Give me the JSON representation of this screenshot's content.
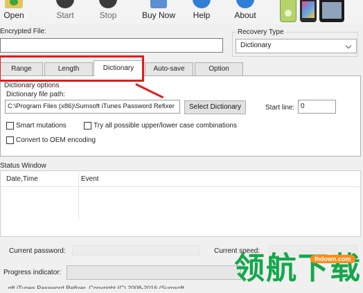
{
  "toolbar": {
    "buttons": [
      {
        "label": "Open",
        "icon": "open-folder-icon"
      },
      {
        "label": "Start",
        "icon": "play-icon"
      },
      {
        "label": "Stop",
        "icon": "stop-icon"
      },
      {
        "label": "Buy Now",
        "icon": "shopping-cart-icon"
      },
      {
        "label": "Help",
        "icon": "help-icon"
      },
      {
        "label": "About",
        "icon": "info-icon"
      }
    ],
    "devices": [
      "ipod-icon",
      "iphone-icon",
      "ipad-icon"
    ]
  },
  "encrypted_file": {
    "label": "Encrypted File:",
    "value": ""
  },
  "recovery_type": {
    "label": "Recovery Type",
    "selected": "Dictionary"
  },
  "tabs": [
    {
      "label": "Range"
    },
    {
      "label": "Length"
    },
    {
      "label": "Dictionary"
    },
    {
      "label": "Auto-save"
    },
    {
      "label": "Option"
    }
  ],
  "active_tab": "Dictionary",
  "dictionary": {
    "group_label": "Dictionary options",
    "path_label": "Dictionary file path:",
    "path_value": "C:\\Program Files (x86)\\Sumsoft iTunes Password Refixer",
    "select_button": "Select Dictionary",
    "start_line_label": "Start line:",
    "start_line_value": "0",
    "options": [
      {
        "label": "Smart mutations",
        "checked": false
      },
      {
        "label": "Try all possible upper/lower case combinations",
        "checked": false
      },
      {
        "label": "Convert to OEM encoding",
        "checked": false
      }
    ]
  },
  "status": {
    "group_label": "Status Window",
    "columns": [
      "Date,Time",
      "Event"
    ],
    "rows": []
  },
  "current_password_label": "Current password:",
  "current_speed_label": "Current speed:",
  "progress_label": "Progress indicator:",
  "progress_value": 0,
  "watermark": {
    "text": "领航下载",
    "badge": "lhdown.com"
  },
  "footer": "...oft iTunes Password Refixer. Copyright (C) 2008-2016 (Sumsoft"
}
